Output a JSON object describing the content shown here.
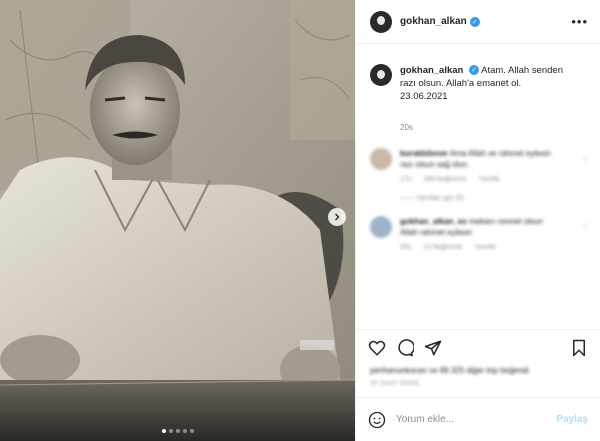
{
  "post": {
    "author": {
      "username": "gokhan_alkan",
      "verified": true
    },
    "caption": {
      "username": "gokhan_alkan",
      "line1": "Atam. Allah senden",
      "line2": "razı olsun. Allah'a emanet ol.",
      "line3": "23.06.2021"
    },
    "time_ago": "20s",
    "comments": [
      {
        "username": "burakbilener",
        "text": "Ama Allah ve rahmet eylesin razı olsun sağ olun.",
        "time": "17s",
        "likes": "289 beğenme",
        "reply": "Yanıtla",
        "replies": "—— Yanıtları gör (5)"
      },
      {
        "username": "gokhan_alkan_es",
        "text": "mekanı cennet olsun Allah rahmet eylesin",
        "time": "20s",
        "likes": "12 beğenme",
        "reply": "Yanıtla"
      }
    ],
    "likes_text": "perihanunkocan ve 89.325 diğer kişi beğendi",
    "date_text": "20 SAAT ÖNCE",
    "add_comment": {
      "placeholder": "Yorum ekle...",
      "post_label": "Paylaş"
    }
  },
  "icons": {
    "more": "more-horizontal-icon",
    "like": "heart-icon",
    "comment": "comment-bubble-icon",
    "share": "paper-plane-icon",
    "save": "bookmark-icon",
    "emoji": "smiley-icon",
    "next": "chevron-right-icon"
  },
  "colors": {
    "accent": "#3897f0",
    "post_button": "#b2dffc",
    "meta": "#8e8e8e"
  }
}
